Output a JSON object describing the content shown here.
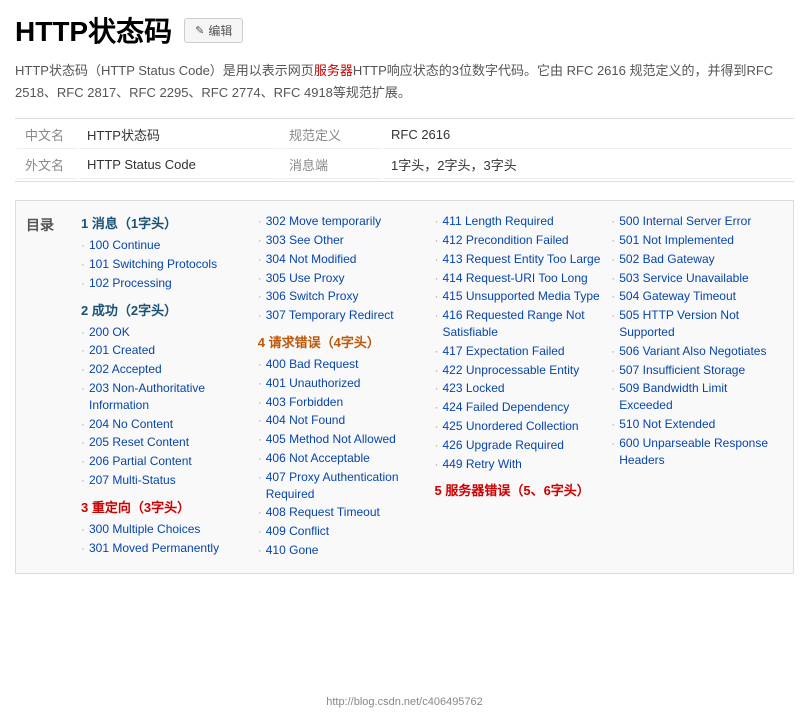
{
  "header": {
    "title": "HTTP状态码",
    "edit_label": "编辑",
    "pencil": "✎"
  },
  "intro": {
    "text1": "HTTP状态码（HTTP Status Code）是用以表示网页",
    "highlight": "服务器",
    "text2": "HTTP响应状态的3位数字代码。它由 RFC 2616 规范定义的，并得到RFC 2518、RFC 2817、RFC 2295、RFC 2774、RFC 4918等规范扩展。"
  },
  "info_rows": [
    {
      "label": "中文名",
      "value": "HTTP状态码",
      "key3": "规范定义",
      "val3": "RFC 2616"
    },
    {
      "label": "外文名",
      "value": "HTTP Status Code",
      "key3": "消息端",
      "val3": "1字头，2字头，3字头"
    }
  ],
  "toc_label": "目录",
  "columns": [
    {
      "sections": [
        {
          "heading": "1 消息（1字头）",
          "heading_color": "blue",
          "items": [
            "100 Continue",
            "101 Switching Protocols",
            "102 Processing"
          ]
        },
        {
          "heading": "2 成功（2字头）",
          "heading_color": "blue",
          "items": [
            "200 OK",
            "201 Created",
            "202 Accepted",
            "203 Non-Authoritative Information",
            "204 No Content",
            "205 Reset Content",
            "206 Partial Content",
            "207 Multi-Status"
          ]
        },
        {
          "heading": "3 重定向（3字头）",
          "heading_color": "red",
          "items": [
            "300 Multiple Choices",
            "301 Moved Permanently"
          ]
        }
      ]
    },
    {
      "sections": [
        {
          "heading": "",
          "heading_color": "none",
          "items": [
            "302 Move temporarily",
            "303 See Other",
            "304 Not Modified",
            "305 Use Proxy",
            "306 Switch Proxy",
            "307 Temporary Redirect"
          ]
        },
        {
          "heading": "4 请求错误（4字头）",
          "heading_color": "orange",
          "items": [
            "400 Bad Request",
            "401 Unauthorized",
            "403 Forbidden",
            "404 Not Found",
            "405 Method Not Allowed",
            "406 Not Acceptable",
            "407 Proxy Authentication Required",
            "408 Request Timeout",
            "409 Conflict",
            "410 Gone"
          ]
        }
      ]
    },
    {
      "sections": [
        {
          "heading": "",
          "heading_color": "none",
          "items": [
            "411 Length Required",
            "412 Precondition Failed",
            "413 Request Entity Too Large",
            "414 Request-URI Too Long",
            "415 Unsupported Media Type",
            "416 Requested Range Not Satisfiable",
            "417 Expectation Failed",
            "422 Unprocessable Entity",
            "423 Locked",
            "424 Failed Dependency",
            "425 Unordered Collection",
            "426 Upgrade Required",
            "449 Retry With"
          ]
        },
        {
          "heading": "5 服务器错误（5、6字头）",
          "heading_color": "red",
          "items": []
        }
      ]
    },
    {
      "sections": [
        {
          "heading": "",
          "heading_color": "none",
          "items": [
            "500 Internal Server Error",
            "501 Not Implemented",
            "502 Bad Gateway",
            "503 Service Unavailable",
            "504 Gateway Timeout",
            "505 HTTP Version Not Supported",
            "506 Variant Also Negotiates",
            "507 Insufficient Storage",
            "509 Bandwidth Limit Exceeded",
            "510 Not Extended",
            "600 Unparseable Response Headers"
          ]
        }
      ]
    }
  ],
  "watermark": "http://blog.csdn.net/c406495762"
}
